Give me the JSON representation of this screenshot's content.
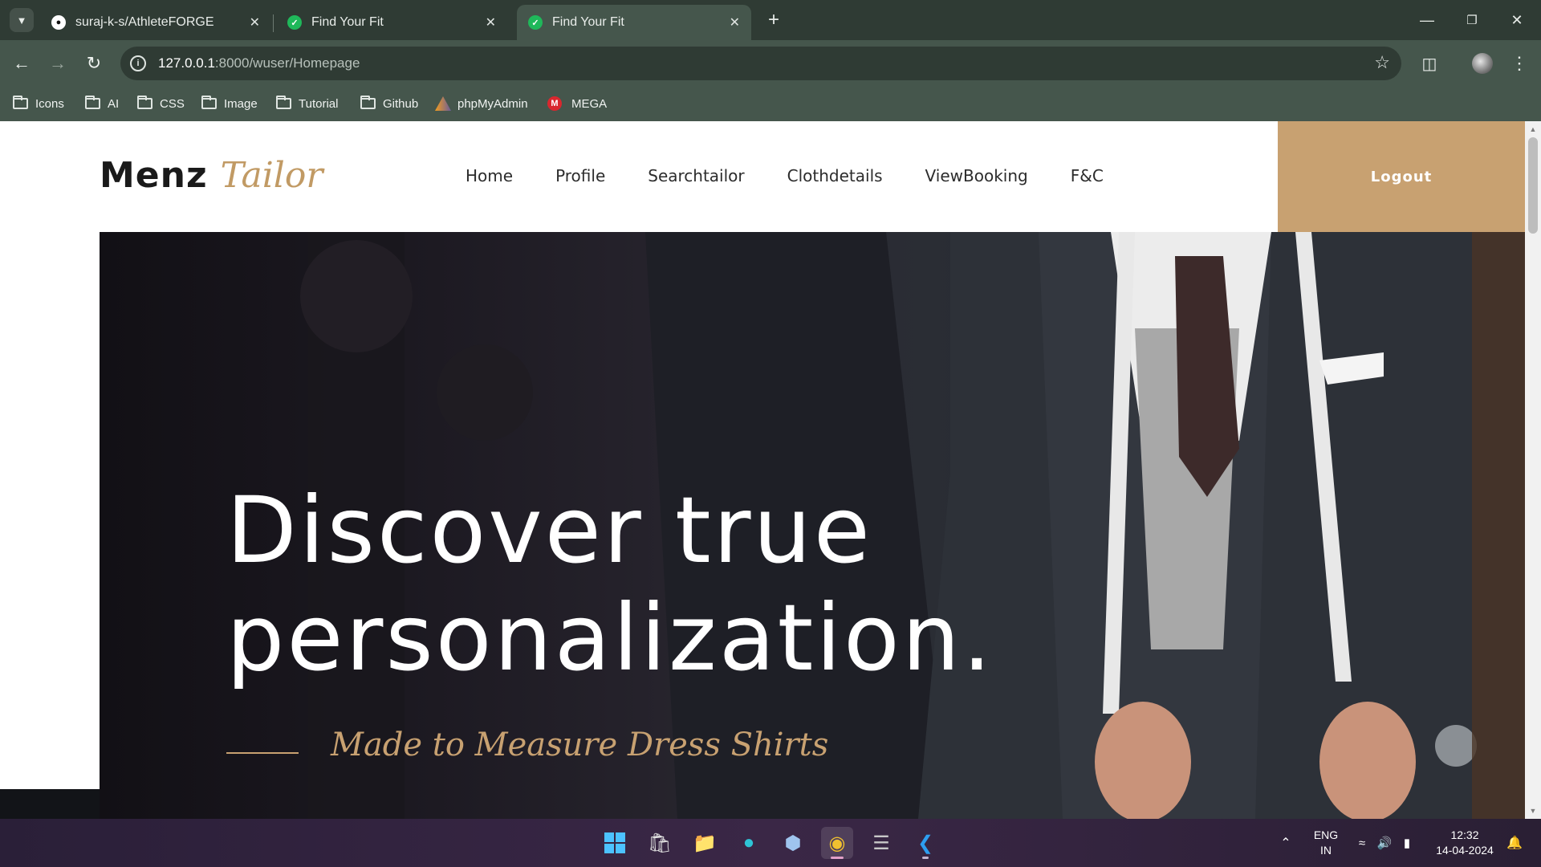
{
  "browser": {
    "tabs": [
      {
        "title": "suraj-k-s/AthleteFORGE",
        "favicon": "github-icon",
        "active": false
      },
      {
        "title": "Find Your Fit",
        "favicon": "check-circle-icon",
        "active": false
      },
      {
        "title": "Find Your Fit",
        "favicon": "check-circle-icon",
        "active": true
      }
    ],
    "url_host": "127.0.0.1",
    "url_path": ":8000/wuser/Homepage",
    "bookmarks": [
      {
        "label": "Icons",
        "icon": "folder-icon"
      },
      {
        "label": "AI",
        "icon": "folder-icon"
      },
      {
        "label": "CSS",
        "icon": "folder-icon"
      },
      {
        "label": "Image",
        "icon": "folder-icon"
      },
      {
        "label": "Tutorial",
        "icon": "folder-icon"
      },
      {
        "label": "Github",
        "icon": "folder-icon"
      },
      {
        "label": "phpMyAdmin",
        "icon": "phpmyadmin-icon"
      },
      {
        "label": "MEGA",
        "icon": "mega-icon"
      }
    ],
    "colors": {
      "tabbar": "#2f3b34",
      "toolbar": "#45564c"
    }
  },
  "site": {
    "logo": {
      "part1": "Menz",
      "part2": "Tailor"
    },
    "nav": [
      "Home",
      "Profile",
      "Searchtailor",
      "Clothdetails",
      "ViewBooking",
      "F&C"
    ],
    "logout_label": "Logout",
    "hero": {
      "title_line1": "Discover true",
      "title_line2": "personalization.",
      "subtitle": "Made to Measure Dress Shirts"
    },
    "colors": {
      "accent": "#c8a171",
      "text": "#2c2c2c"
    }
  },
  "taskbar": {
    "apps": [
      "windows-start-icon",
      "microsoft-store-icon",
      "file-explorer-icon",
      "edge-icon",
      "virtualbox-icon",
      "chrome-icon",
      "database-icon",
      "vscode-icon"
    ],
    "language": {
      "line1": "ENG",
      "line2": "IN"
    },
    "time": "12:32",
    "date": "14-04-2024"
  }
}
